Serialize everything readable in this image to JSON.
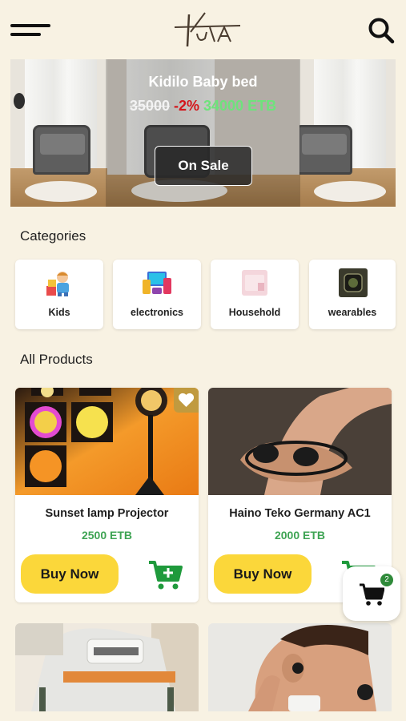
{
  "header": {
    "logo_text": "KUTA",
    "menu_icon": "hamburger-icon",
    "search_icon": "search-icon"
  },
  "banner": {
    "title": "Kidilo Baby bed",
    "old_price": "35000",
    "discount": "-2%",
    "new_price": "34000 ETB",
    "cta": "On Sale"
  },
  "categories": {
    "title": "Categories",
    "items": [
      {
        "label": "Kids",
        "icon": "kids-icon"
      },
      {
        "label": "electronics",
        "icon": "electronics-icon"
      },
      {
        "label": "Household",
        "icon": "household-icon"
      },
      {
        "label": "wearables",
        "icon": "wearables-icon"
      }
    ]
  },
  "products": {
    "title": "All Products",
    "items": [
      {
        "name": "Sunset lamp Projector",
        "price": "2500 ETB",
        "buy_label": "Buy Now"
      },
      {
        "name": "Haino Teko Germany AC1",
        "price": "2000 ETB",
        "buy_label": "Buy Now"
      }
    ]
  },
  "cart": {
    "count": "2"
  },
  "colors": {
    "background": "#f8f2e3",
    "accent_yellow": "#fbd73a",
    "price_green": "#3fa454",
    "cart_green": "#1f9a3c"
  }
}
